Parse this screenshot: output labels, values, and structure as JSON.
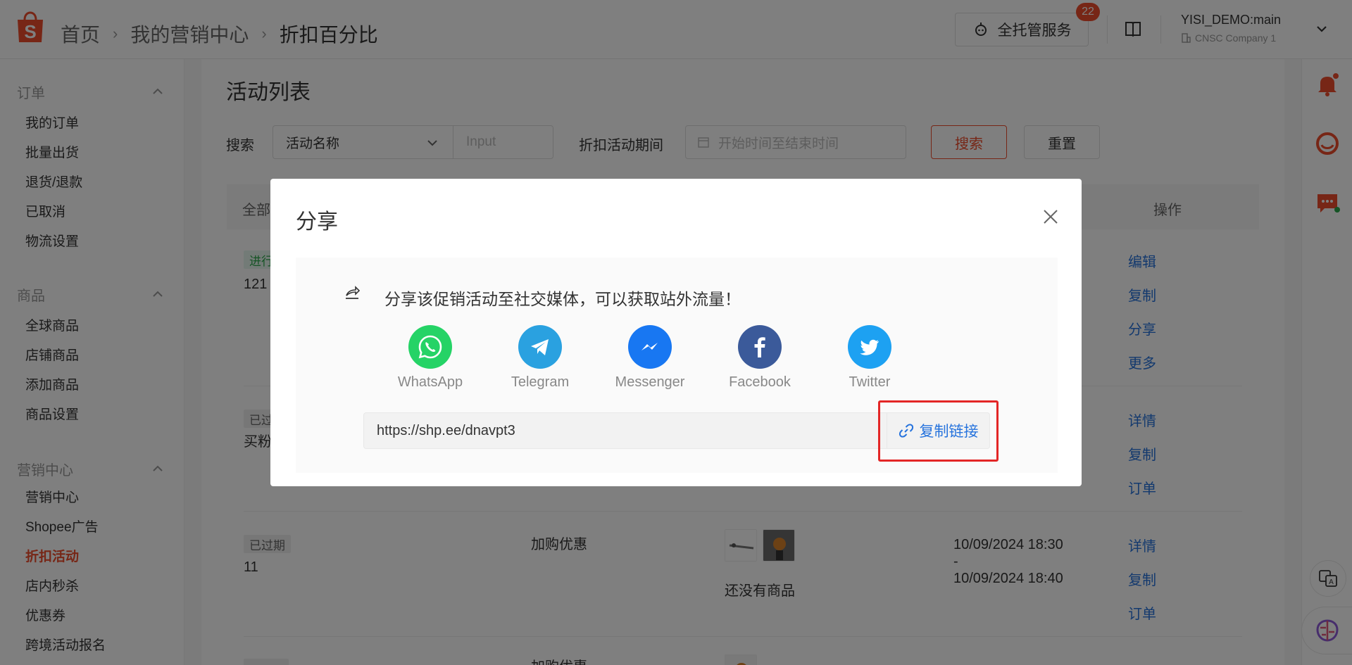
{
  "header": {
    "breadcrumb": [
      "首页",
      "我的营销中心",
      "折扣百分比"
    ],
    "service_label": "全托管服务",
    "notification_count": "22",
    "account_name": "YISI_DEMO:main",
    "company_name": "CNSC Company 1"
  },
  "sidebar": {
    "sections": [
      {
        "title": "订单",
        "items": [
          "我的订单",
          "批量出货",
          "退货/退款",
          "已取消",
          "物流设置"
        ]
      },
      {
        "title": "商品",
        "items": [
          "全球商品",
          "店铺商品",
          "添加商品",
          "商品设置"
        ]
      },
      {
        "title": "营销中心",
        "items": [
          "营销中心",
          "Shopee广告",
          "折扣活动",
          "店内秒杀",
          "优惠券",
          "跨境活动报名"
        ]
      }
    ],
    "active_item": "折扣活动"
  },
  "main": {
    "title": "活动列表",
    "search_label": "搜索",
    "search_select": "活动名称",
    "search_placeholder": "Input",
    "period_label": "折扣活动期间",
    "period_placeholder": "开始时间至结束时间",
    "search_button": "搜索",
    "reset_button": "重置",
    "table_header_left": "全部",
    "table_header_action": "操作",
    "rows": [
      {
        "status": "进行",
        "name": "121",
        "actions": [
          "编辑",
          "复制",
          "分享",
          "更多"
        ]
      },
      {
        "status": "已过",
        "name": "买粉",
        "actions": [
          "详情",
          "复制",
          "订单"
        ]
      },
      {
        "status": "已过期",
        "name": "11",
        "type": "加购优惠",
        "no_products": "还没有商品",
        "time_start": "10/09/2024 18:30",
        "time_sep": "-",
        "time_end": "10/09/2024 18:40",
        "actions": [
          "详情",
          "复制",
          "订单"
        ]
      },
      {
        "type": "加购优惠"
      }
    ]
  },
  "modal": {
    "title": "分享",
    "message": "分享该促销活动至社交媒体，可以获取站外流量！",
    "socials": [
      {
        "name": "WhatsApp",
        "icon": "whatsapp-icon",
        "color": "#25d366"
      },
      {
        "name": "Telegram",
        "icon": "telegram-icon",
        "color": "#2aa1e0"
      },
      {
        "name": "Messenger",
        "icon": "messenger-icon",
        "color": "#1877f2"
      },
      {
        "name": "Facebook",
        "icon": "facebook-icon",
        "color": "#3b5a9a"
      },
      {
        "name": "Twitter",
        "icon": "twitter-icon",
        "color": "#1da1f2"
      }
    ],
    "link": "https://shp.ee/dnavpt3",
    "copy_label": "复制链接"
  },
  "colors": {
    "brand": "#ee4d2d",
    "link": "#2673dd",
    "highlight": "#e32626"
  }
}
